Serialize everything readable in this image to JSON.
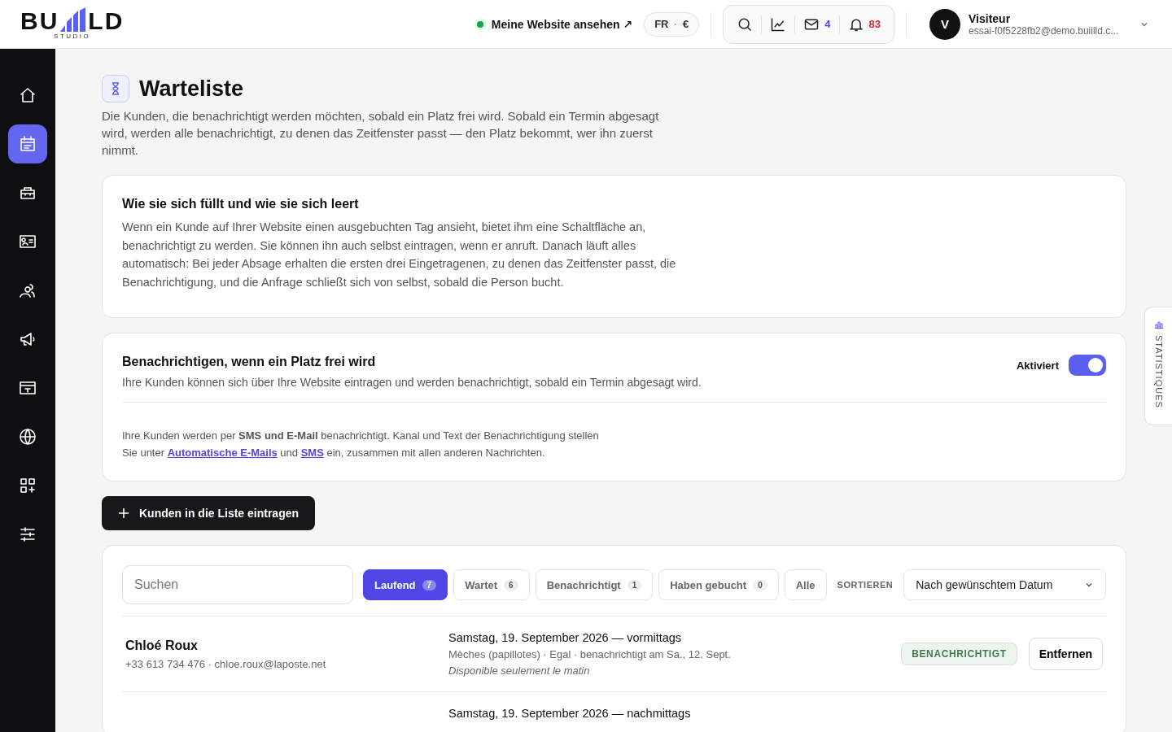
{
  "header": {
    "logo": {
      "left": "BU",
      "right": "LD",
      "sub": "STUDIO"
    },
    "website_link": {
      "label": "Meine Website ansehen ↗",
      "online": true
    },
    "locale": {
      "language": "FR",
      "separator": "·",
      "currency": "€"
    },
    "mail_count": "4",
    "notification_count": "83",
    "user": {
      "initial": "V",
      "name": "Visiteur",
      "email": "essai-f0f5228fb2@demo.buiiild.c..."
    }
  },
  "sidebar": {
    "items": [
      {
        "kind": "home",
        "selected": false
      },
      {
        "kind": "calendar",
        "selected": true
      },
      {
        "kind": "briefcase",
        "selected": false
      },
      {
        "kind": "contact-card",
        "selected": false
      },
      {
        "kind": "people",
        "selected": false
      },
      {
        "kind": "megaphone",
        "selected": false
      },
      {
        "kind": "card",
        "selected": false
      },
      {
        "kind": "globe",
        "selected": false
      },
      {
        "kind": "apps",
        "selected": false
      },
      {
        "kind": "sliders",
        "selected": false
      }
    ]
  },
  "page": {
    "title": "Warteliste",
    "description": "Die Kunden, die benachrichtigt werden möchten, sobald ein Platz frei wird. Sobald ein Termin abgesagt wird, werden alle benachrichtigt, zu denen das Zeitfenster passt — den Platz bekommt, wer ihn zuerst nimmt."
  },
  "info_card": {
    "title": "Wie sie sich füllt und wie sie sich leert",
    "text": "Wenn ein Kunde auf Ihrer Website einen ausgebuchten Tag ansieht, bietet ihm eine Schaltfläche an, benachrichtigt zu werden. Sie können ihn auch selbst eintragen, wenn er anruft. Danach läuft alles automatisch: Bei jeder Absage erhalten die ersten drei Eingetragenen, zu denen das Zeitfenster passt, die Benachrichtigung, und die Anfrage schließt sich von selbst, sobald die Person bucht."
  },
  "notify_card": {
    "title": "Benachrichtigen, wenn ein Platz frei wird",
    "subtitle": "Ihre Kunden können sich über Ihre Website eintragen und werden benachrichtigt, sobald ein Termin abgesagt wird.",
    "toggle_label": "Aktiviert",
    "on": true,
    "note_line_1": "Ihre Kunden werden per **SMS und E-Mail** benachrichtigt. Kanal und Text der Benachrichtigung stellen",
    "note_line_2": {
      "before": "Sie unter",
      "link_1": "Automatische E-Mails",
      "middle": "und",
      "link_2": "SMS",
      "after": "ein, zusammen mit allen anderen Nachrichten."
    }
  },
  "add_button": {
    "label": "Kunden in die Liste eintragen"
  },
  "list": {
    "search": {
      "placeholder": "Suchen"
    },
    "filters": [
      {
        "label": "Laufend",
        "count": "7",
        "selected": true
      },
      {
        "label": "Wartet",
        "count": "6",
        "selected": false
      },
      {
        "label": "Benachrichtigt",
        "count": "1",
        "selected": false
      },
      {
        "label": "Haben gebucht",
        "count": "0",
        "selected": false
      },
      {
        "label": "Alle",
        "selected": false
      }
    ],
    "sort_label": "SORTIEREN",
    "sort_value": "Nach gewünschtem Datum",
    "rows": [
      {
        "name": "Chloé Roux",
        "contact": "+33 613 734 476 · chloe.roux@laposte.net",
        "date": "Samstag, 19. September 2026 — vormittags",
        "details": "Mèches (papillotes) · Egal · benachrichtigt am Sa., 12. Sept.",
        "note": "Disponible seulement le matin",
        "status": "BENACHRICHTIGT",
        "action": "Entfernen"
      },
      {
        "date": "Samstag, 19. September 2026 — nachmittags"
      }
    ]
  },
  "side_tab": {
    "label": "STATISTIQUES"
  }
}
